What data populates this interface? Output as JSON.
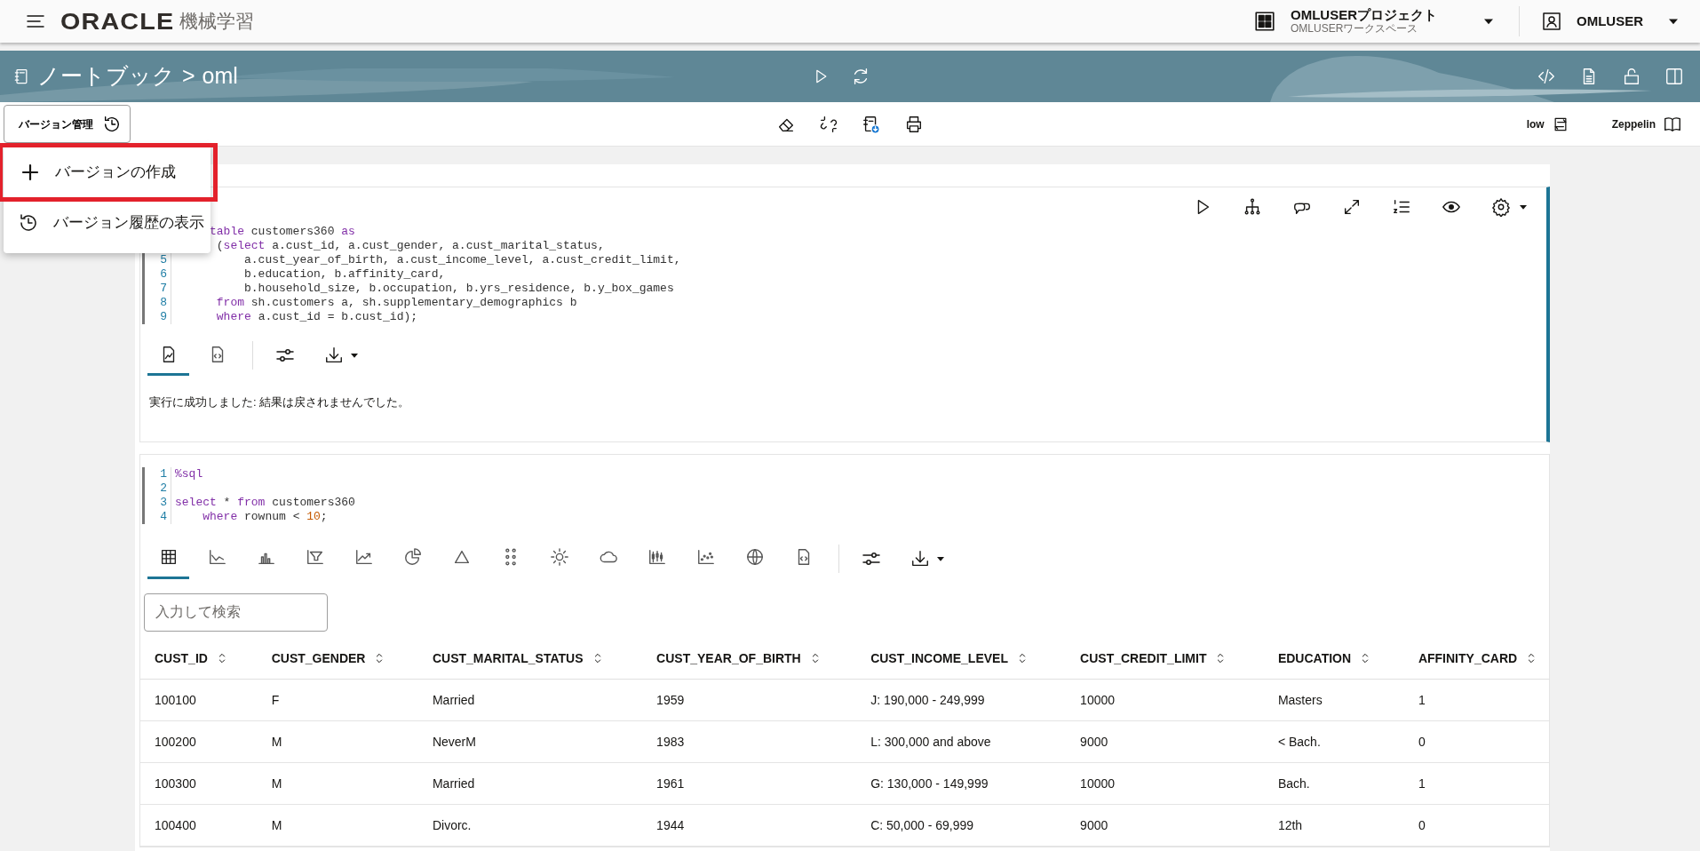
{
  "header": {
    "brand": "ORACLE",
    "product": "機械学習",
    "project": "OMLUSERプロジェクト",
    "workspace": "OMLUSERワークスペース",
    "user": "OMLUSER"
  },
  "banner": {
    "root": "ノートブック",
    "separator": ">",
    "notebook": "oml"
  },
  "toolbar": {
    "version_button": "バージョン管理",
    "connection": "low",
    "interpreter": "Zeppelin"
  },
  "version_menu": [
    {
      "label": "バージョンの作成",
      "kind": "create",
      "highlighted": true
    },
    {
      "label": "バージョン履歴の表示",
      "kind": "history",
      "highlighted": false
    }
  ],
  "paragraphs": [
    {
      "selected": true,
      "code": [
        {
          "segments": [
            {
              "text": "     table",
              "kind": "keyword"
            },
            {
              "text": " customers360 "
            },
            {
              "text": "as",
              "kind": "keyword"
            }
          ]
        },
        {
          "segments": [
            {
              "text": "      ("
            },
            {
              "text": "select",
              "kind": "keyword"
            },
            {
              "text": " a.cust_id, a.cust_gender, a.cust_marital_status,"
            }
          ]
        },
        {
          "number": "5",
          "segments": [
            {
              "text": "          a.cust_year_of_birth, a.cust_income_level, a.cust_credit_limit,"
            }
          ]
        },
        {
          "number": "6",
          "segments": [
            {
              "text": "          b.education, b.affinity_card,"
            }
          ]
        },
        {
          "number": "7",
          "segments": [
            {
              "text": "          b.household_size, b.occupation, b.yrs_residence, b.y_box_games"
            }
          ]
        },
        {
          "number": "8",
          "segments": [
            {
              "text": "      from",
              "kind": "keyword"
            },
            {
              "text": " sh.customers a, sh.supplementary_demographics b"
            }
          ]
        },
        {
          "number": "9",
          "segments": [
            {
              "text": "      where",
              "kind": "keyword"
            },
            {
              "text": " a.cust_id = b.cust_id);"
            }
          ]
        }
      ],
      "view_tabs": [
        {
          "selected": true
        },
        {
          "selected": false
        }
      ],
      "message": "実行に成功しました: 結果は戻されませんでした。"
    },
    {
      "selected": false,
      "code": [
        {
          "number": "1",
          "segments": [
            {
              "text": "%sql",
              "kind": "keyword"
            }
          ]
        },
        {
          "number": "2"
        },
        {
          "number": "3",
          "segments": [
            {
              "text": "select",
              "kind": "keyword"
            },
            {
              "text": " * "
            },
            {
              "text": "from",
              "kind": "keyword"
            },
            {
              "text": " customers360"
            }
          ]
        },
        {
          "number": "4",
          "segments": [
            {
              "text": "    where",
              "kind": "keyword"
            },
            {
              "text": " rownum < "
            },
            {
              "text": "10",
              "kind": "number"
            },
            {
              "text": ";"
            }
          ]
        }
      ],
      "view_tabs": [
        {
          "selected": true
        },
        {
          "selected": false
        },
        {
          "selected": false
        },
        {
          "selected": false
        },
        {
          "selected": false
        },
        {
          "selected": false
        },
        {
          "selected": false
        },
        {
          "selected": false
        },
        {
          "selected": false
        },
        {
          "selected": false
        },
        {
          "selected": false
        },
        {
          "selected": false
        },
        {
          "selected": false
        },
        {
          "selected": false
        }
      ],
      "search": {
        "placeholder": "入力して検索"
      },
      "table": {
        "columns": [
          "CUST_ID",
          "CUST_GENDER",
          "CUST_MARITAL_STATUS",
          "CUST_YEAR_OF_BIRTH",
          "CUST_INCOME_LEVEL",
          "CUST_CREDIT_LIMIT",
          "EDUCATION",
          "AFFINITY_CARD"
        ],
        "rows": [
          [
            "100100",
            "F",
            "Married",
            "1959",
            "J: 190,000 - 249,999",
            "10000",
            "Masters",
            "1"
          ],
          [
            "100200",
            "M",
            "NeverM",
            "1983",
            "L: 300,000 and above",
            "9000",
            "< Bach.",
            "0"
          ],
          [
            "100300",
            "M",
            "Married",
            "1961",
            "G: 130,000 - 149,999",
            "10000",
            "Bach.",
            "1"
          ],
          [
            "100400",
            "M",
            "Divorc.",
            "1944",
            "C: 50,000 - 69,999",
            "9000",
            "12th",
            "0"
          ]
        ]
      }
    }
  ]
}
